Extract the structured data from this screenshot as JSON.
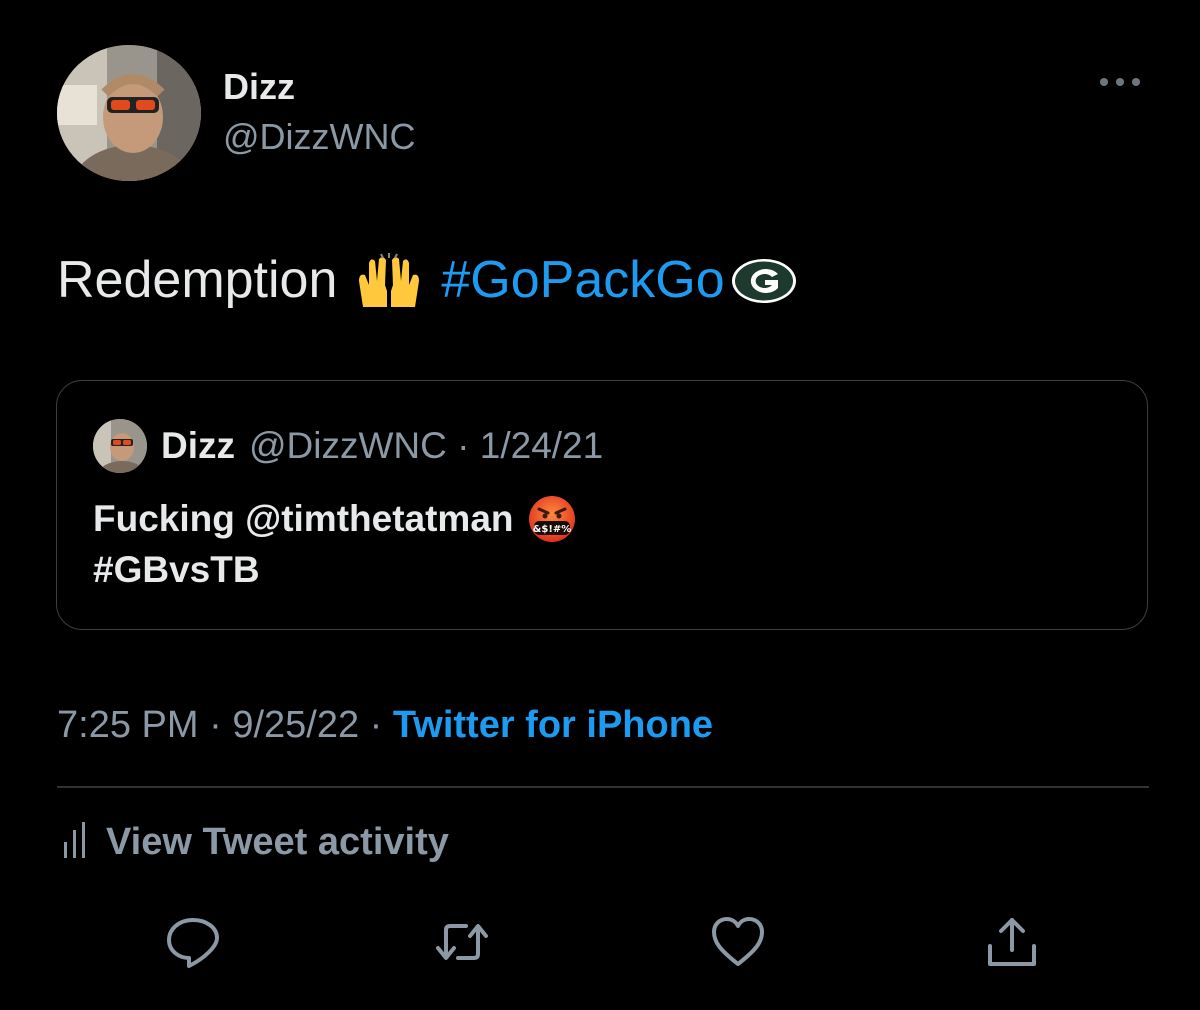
{
  "tweet": {
    "display_name": "Dizz",
    "handle": "@DizzWNC",
    "text_word": "Redemption",
    "hashtag": "#GoPackGo",
    "emoji_hands": "raising-hands",
    "emoji_team": "green-bay-packers-logo"
  },
  "quote": {
    "display_name": "Dizz",
    "handle": "@DizzWNC",
    "separator": "·",
    "date": "1/24/21",
    "line1": "Fucking @timthetatman",
    "emoji_angry": "face-with-symbols-on-mouth",
    "line2": "#GBvsTB"
  },
  "meta": {
    "time": "7:25 PM",
    "sep1": " · ",
    "date": "9/25/22",
    "sep2": " · ",
    "source": "Twitter for iPhone"
  },
  "activity": {
    "label": "View Tweet activity",
    "icon": "bar-chart-icon"
  },
  "actions": [
    "reply-icon",
    "retweet-icon",
    "like-icon",
    "share-icon"
  ],
  "colors": {
    "background": "#000000",
    "primary_text": "#e7e9ea",
    "secondary_text": "#8b98a5",
    "accent": "#1d9bf0",
    "border": "#2f3336"
  }
}
